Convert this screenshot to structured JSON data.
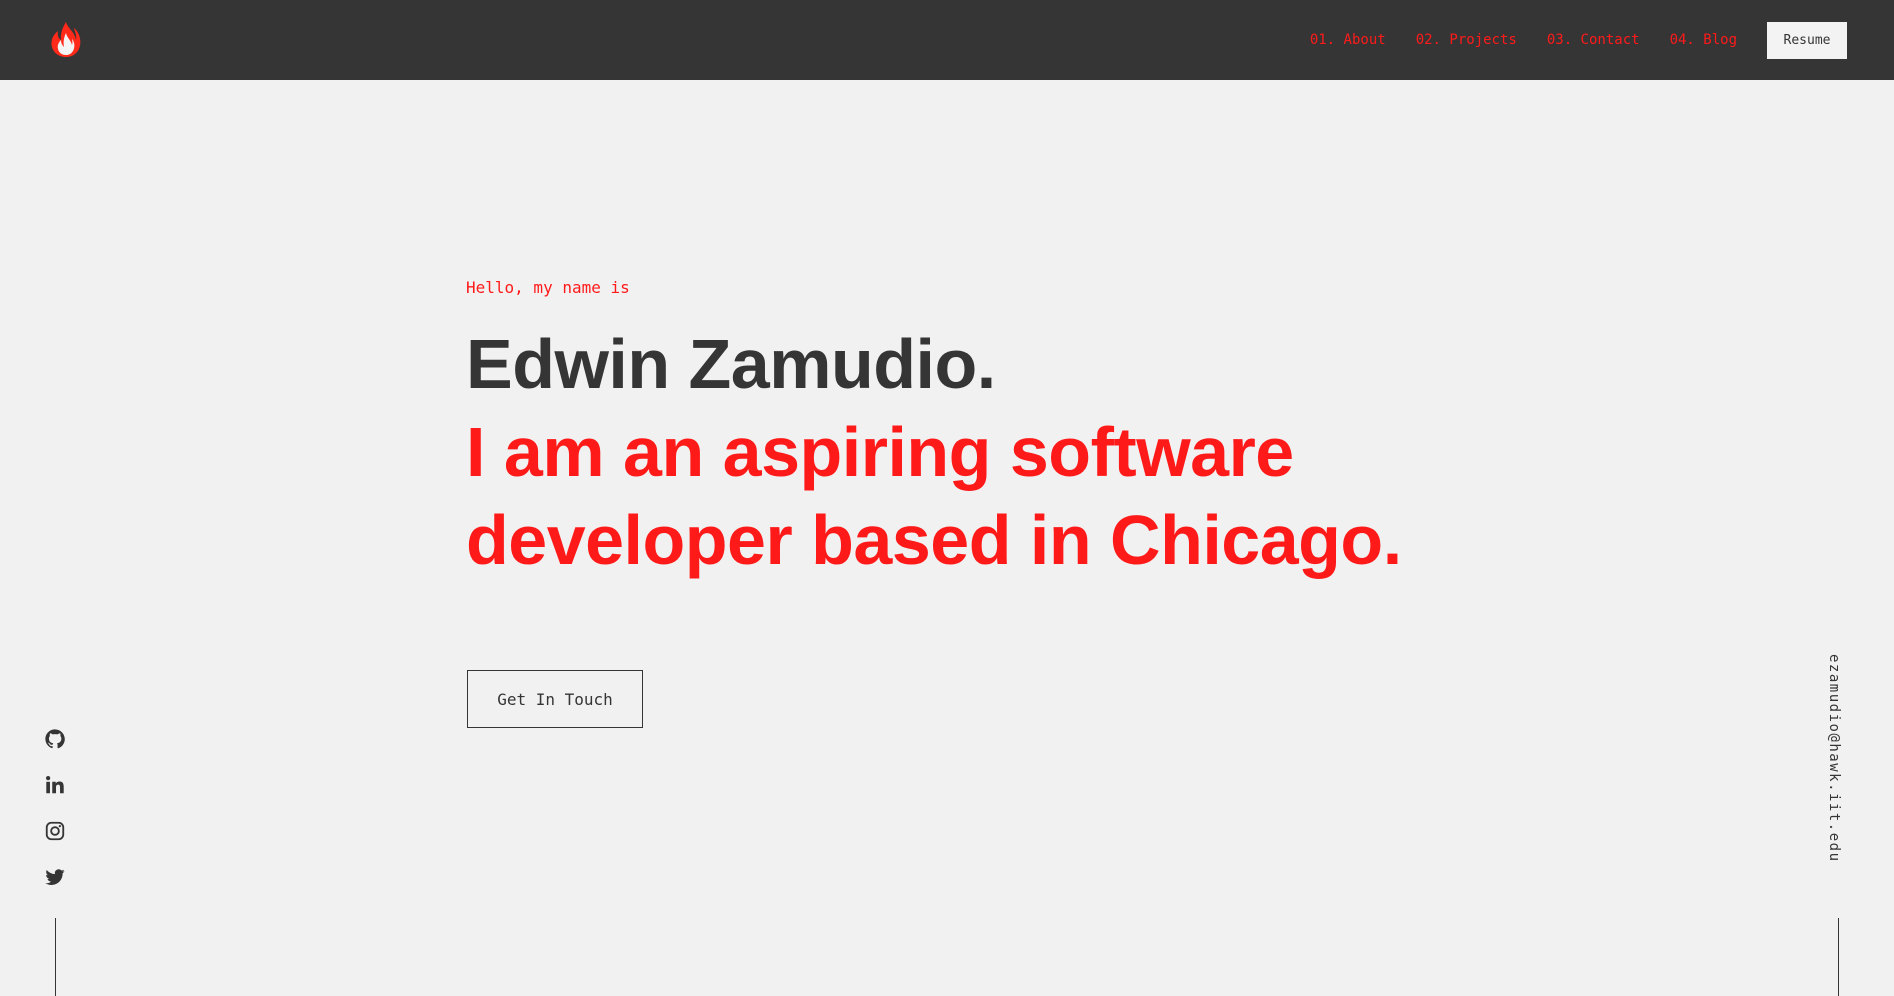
{
  "nav": {
    "logo_icon": "flame-icon",
    "links": [
      {
        "label": "01. About"
      },
      {
        "label": "02. Projects"
      },
      {
        "label": "03. Contact"
      },
      {
        "label": "04. Blog"
      }
    ],
    "resume_label": "Resume"
  },
  "hero": {
    "greeting": "Hello, my name is",
    "name": "Edwin Zamudio.",
    "tagline": "I am an aspiring software developer based in Chicago.",
    "cta_label": "Get In Touch"
  },
  "social": [
    {
      "icon": "github-icon"
    },
    {
      "icon": "linkedin-icon"
    },
    {
      "icon": "instagram-icon"
    },
    {
      "icon": "twitter-icon"
    }
  ],
  "email": "ezamudio@hawk.iit.edu",
  "colors": {
    "accent": "#ff1a1a",
    "dark": "#353535",
    "background": "#f1f1f1"
  }
}
